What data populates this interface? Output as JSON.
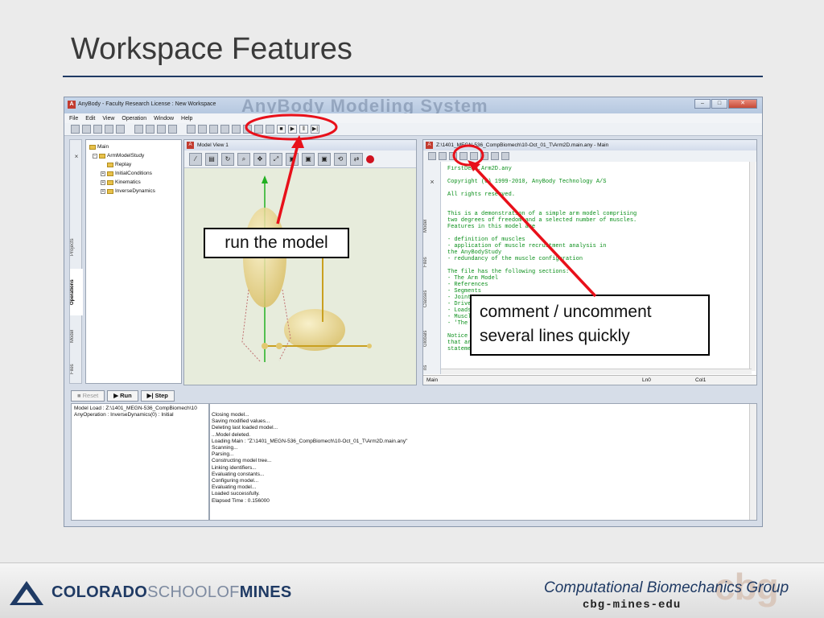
{
  "slide": {
    "title": "Workspace Features"
  },
  "app": {
    "title": "AnyBody - Faculty Research License : New Workspace",
    "brand_watermark": "AnyBody Modeling System",
    "menu": [
      "File",
      "Edit",
      "View",
      "Operation",
      "Window",
      "Help"
    ],
    "window_buttons": [
      "min-icon",
      "max-icon",
      "close-icon"
    ]
  },
  "left_panel": {
    "tabs": [
      "Projects",
      "Operations",
      "Model",
      "Files"
    ],
    "active_tab": "Operations",
    "close_mark": "×",
    "tree": [
      {
        "label": "Main",
        "depth": 0
      },
      {
        "label": "ArmModelStudy",
        "depth": 1
      },
      {
        "label": "Replay",
        "depth": 2
      },
      {
        "label": "InitialConditions",
        "depth": 2
      },
      {
        "label": "Kinematics",
        "depth": 2
      },
      {
        "label": "InverseDynamics",
        "depth": 2
      }
    ]
  },
  "model_view": {
    "title": "Model View 1"
  },
  "editor": {
    "title": "Z:\\1401_MEGN-536_CompBiomech\\10-Oct_01_T\\Arm2D.main.any - Main",
    "side_tabs": [
      "Model",
      "Files",
      "Classes",
      "Globals",
      "ns"
    ],
    "close_mark": "×",
    "code_lines": [
      "FirstDemo.Arm2D.any",
      "",
      "Copyright (c) 1999-2010, AnyBody Technology A/S",
      "",
      "All rights reserved.",
      "",
      "",
      "This is a demonstration of a simple arm model comprising",
      "two degrees of freedom and a selected number of muscles.",
      "Features in this model are",
      "",
      "- definition of muscles",
      "- application of muscle recruitment analysis in",
      "the AnyBodyStudy",
      "- redundancy of the muscle configuration",
      "",
      "The file has the following sections:",
      "- The Arm Model",
      "- References",
      "- Segments",
      "- Joints",
      "- Drivers",
      "- Loads",
      "- Muscles",
      "- 'The",
      "",
      "Notice",
      "that are assemble in a single main file by include",
      "statements. All include statements must be inside the"
    ],
    "status": {
      "name": "Main",
      "line": "Ln0",
      "col": "Col1"
    }
  },
  "run_controls": {
    "reset": "Reset",
    "run": "Run",
    "step": "Step"
  },
  "operation_info": [
    "Model Load : Z:\\1401_MEGN-536_CompBiomech\\10",
    "AnyOperation : InverseDynamics(0) : Initial"
  ],
  "log_lines": [
    "Closing model...",
    "Saving modified values...",
    "Deleting last loaded model...",
    "...Model deleted.",
    "Loading  Main  :  \"Z:\\1401_MEGN-536_CompBiomech\\10-Oct_01_T\\Arm2D.main.any\"",
    "Scanning...",
    "Parsing...",
    "Constructing model tree...",
    "Linking identifiers...",
    "Evaluating constants...",
    "Configuring model...",
    "Evaluating model...",
    "Loaded successfully.",
    "Elapsed Time : 0.156000"
  ],
  "callouts": {
    "run": "run the model",
    "comment_line1": "comment / uncomment",
    "comment_line2": "several lines quickly"
  },
  "footer": {
    "mines_a": "COLORADO",
    "mines_b": "SCHOOLOF",
    "mines_c": "MINES",
    "cbg_title": "Computational Biomechanics Group",
    "cbg_url": "cbg-mines-edu",
    "cbg_logo": "cbg"
  },
  "colors": {
    "accent_navy": "#1f3a64",
    "annotation_red": "#e8101a",
    "code_green": "#0a8f1a"
  }
}
